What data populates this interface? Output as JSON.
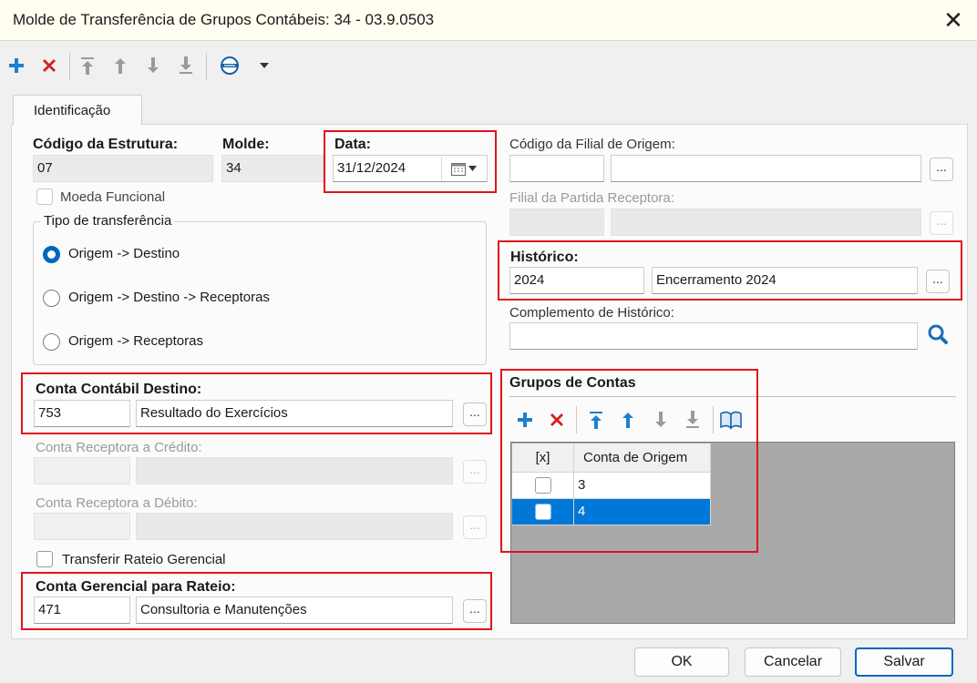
{
  "window": {
    "title": "Molde de Transferência de Grupos Contábeis: 34 - 03.9.0503",
    "close_label": "✕"
  },
  "toolbar": {
    "items": [
      "add-icon",
      "delete-icon",
      "move-top-icon",
      "move-up-icon",
      "move-down-icon",
      "move-bottom-icon",
      "options-icon",
      "dropdown-icon"
    ]
  },
  "tab": {
    "label": "Identificação"
  },
  "form": {
    "codigo_estrutura": {
      "label": "Código da Estrutura:",
      "value": "07"
    },
    "molde": {
      "label": "Molde:",
      "value": "34"
    },
    "data": {
      "label": "Data:",
      "value": "31/12/2024"
    },
    "moeda_funcional": {
      "label": "Moeda Funcional",
      "checked": false
    },
    "tipo_transferencia": {
      "label": "Tipo de transferência",
      "options": [
        "Origem -> Destino",
        "Origem -> Destino -> Receptoras",
        "Origem -> Receptoras"
      ],
      "selected": 0
    },
    "conta_contabil_destino": {
      "label": "Conta Contábil Destino:",
      "code": "753",
      "description": "Resultado do Exercícios"
    },
    "conta_receptora_credito": {
      "label": "Conta Receptora a Crédito:",
      "code": "",
      "description": ""
    },
    "conta_receptora_debito": {
      "label": "Conta Receptora a Débito:",
      "code": "",
      "description": ""
    },
    "transferir_rateio": {
      "label": "Transferir Rateio Gerencial",
      "checked": false
    },
    "conta_gerencial_rateio": {
      "label": "Conta Gerencial para Rateio:",
      "code": "471",
      "description": "Consultoria e Manutenções"
    },
    "codigo_filial_origem": {
      "label": "Código da Filial de Origem:",
      "code": "",
      "description": ""
    },
    "filial_partida_receptora": {
      "label": "Filial da Partida Receptora:",
      "code": "",
      "description": ""
    },
    "historico": {
      "label": "Histórico:",
      "code": "2024",
      "description": "Encerramento 2024"
    },
    "complemento_historico": {
      "label": "Complemento de Histórico:",
      "value": ""
    },
    "ellipsis": "..."
  },
  "grupos": {
    "label": "Grupos de Contas",
    "columns": [
      "[x]",
      "Conta de Origem"
    ],
    "rows": [
      {
        "checked": false,
        "conta": "3",
        "selected": false
      },
      {
        "checked": false,
        "conta": "4",
        "selected": true
      }
    ]
  },
  "buttons": {
    "ok": "OK",
    "cancelar": "Cancelar",
    "salvar": "Salvar"
  },
  "colors": {
    "accent": "#0067c0",
    "highlight_box": "#e0141e",
    "add": "#1e7fd0",
    "delete": "#d42020",
    "selected_row": "#0078d7"
  }
}
